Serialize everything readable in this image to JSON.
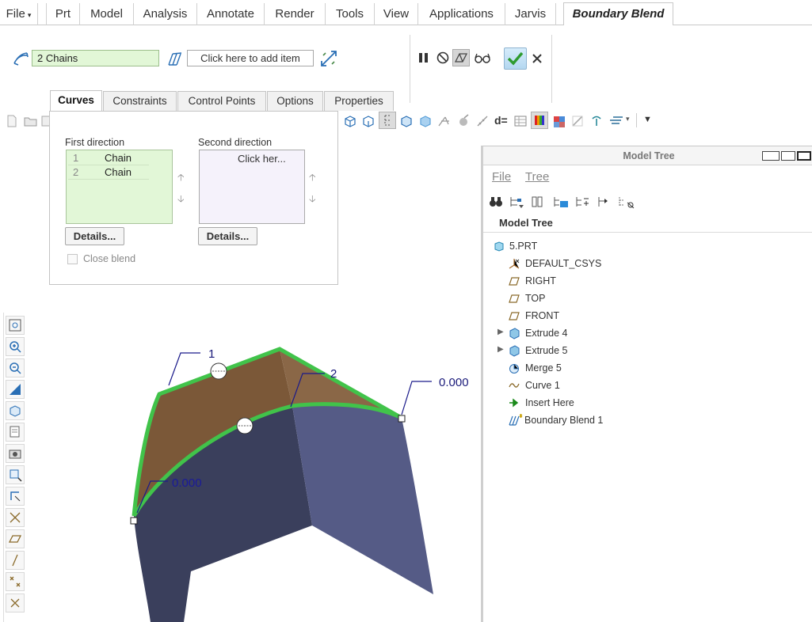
{
  "ribbon": {
    "file": "File",
    "tabs": [
      "Prt",
      "Model",
      "Analysis",
      "Annotate",
      "Render",
      "Tools",
      "View",
      "Applications",
      "Jarvis"
    ],
    "active_tab": "Boundary Blend"
  },
  "dashboard": {
    "first_collector": "2 Chains",
    "second_collector": "Click here to add item"
  },
  "subtabs": [
    "Curves",
    "Constraints",
    "Control Points",
    "Options",
    "Properties"
  ],
  "curves_panel": {
    "first_direction_label": "First direction",
    "second_direction_label": "Second direction",
    "first_items": [
      {
        "num": "1",
        "name": "Chain"
      },
      {
        "num": "2",
        "name": "Chain"
      }
    ],
    "second_placeholder": "Click her...",
    "details_label": "Details...",
    "close_blend_label": "Close blend"
  },
  "viewport": {
    "chain_label_1": "1",
    "chain_label_2": "2",
    "value_right": "0.000",
    "value_left": "0.000"
  },
  "model_tree": {
    "title": "Model Tree",
    "menu_file": "File",
    "menu_tree": "Tree",
    "header": "Model Tree",
    "nodes": [
      {
        "label": "5.PRT",
        "icon": "part-icon"
      },
      {
        "label": "DEFAULT_CSYS",
        "icon": "csys-icon"
      },
      {
        "label": "RIGHT",
        "icon": "datum-plane-icon"
      },
      {
        "label": "TOP",
        "icon": "datum-plane-icon"
      },
      {
        "label": "FRONT",
        "icon": "datum-plane-icon"
      },
      {
        "label": "Extrude 4",
        "icon": "extrude-icon"
      },
      {
        "label": "Extrude 5",
        "icon": "extrude-icon"
      },
      {
        "label": "Merge 5",
        "icon": "merge-icon"
      },
      {
        "label": "Curve 1",
        "icon": "curve-icon"
      },
      {
        "label": "Insert Here",
        "icon": "insert-arrow-icon"
      },
      {
        "label": "Boundary Blend 1",
        "icon": "boundary-blend-icon"
      }
    ]
  },
  "colors": {
    "selection_green": "#41c34a",
    "collector_bg": "#e2f7d7",
    "surface_brown": "#7b5838",
    "surface_dark": "#3a3f5c",
    "surface_blue": "#555b86"
  }
}
